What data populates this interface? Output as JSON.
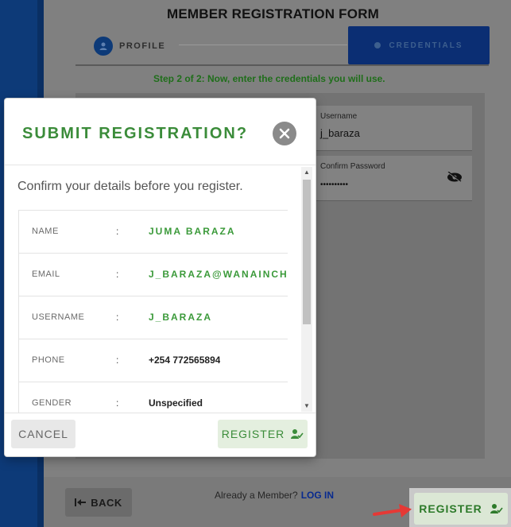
{
  "form": {
    "title": "MEMBER REGISTRATION FORM",
    "steps": [
      {
        "label": "PROFILE",
        "state": "completed"
      },
      {
        "label": "CREDENTIALS",
        "state": "active"
      }
    ],
    "step_note": "Step 2 of 2: Now, enter the credentials you will use.",
    "fields": {
      "username": {
        "label": "Username",
        "value": "j_baraza"
      },
      "confirm_password": {
        "label": "Confirm Password",
        "value": "••••••••••"
      }
    },
    "back_label": "BACK",
    "already_member": "Already a Member?",
    "login_label": "LOG IN",
    "register_label": "REGISTER"
  },
  "modal": {
    "title": "SUBMIT REGISTRATION?",
    "intro": "Confirm your details before you register.",
    "details": [
      {
        "label": "NAME",
        "value": "JUMA BARAZA"
      },
      {
        "label": "EMAIL",
        "value": "J_BARAZA@WANAINCH"
      },
      {
        "label": "USERNAME",
        "value": "J_BARAZA"
      },
      {
        "label": "PHONE",
        "value": "+254 772565894"
      },
      {
        "label": "GENDER",
        "value": "Unspecified"
      }
    ],
    "separator": ":",
    "cancel_label": "CANCEL",
    "register_label": "REGISTER"
  },
  "colors": {
    "accent_green": "#3b8c3a",
    "primary_blue": "#0d3a78"
  },
  "icons": {
    "close": "close-icon",
    "register": "user-check-icon",
    "eye": "eye-off-icon",
    "back": "arrow-left-icon"
  }
}
